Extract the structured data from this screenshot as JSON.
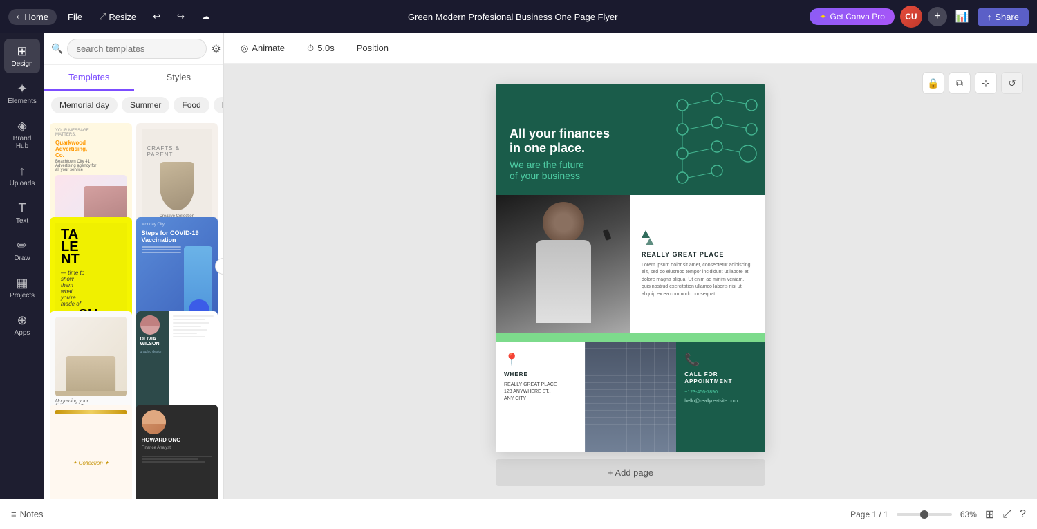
{
  "topbar": {
    "home_label": "Home",
    "file_label": "File",
    "resize_label": "Resize",
    "title": "Green Modern Profesional Business One Page Flyer",
    "canva_pro_label": "Get Canva Pro",
    "share_label": "Share",
    "user_initials": "CU"
  },
  "sidebar": {
    "items": [
      {
        "id": "design",
        "label": "Design",
        "icon": "⊞",
        "active": true
      },
      {
        "id": "elements",
        "label": "Elements",
        "icon": "✦"
      },
      {
        "id": "brand-hub",
        "label": "Brand Hub",
        "icon": "◈"
      },
      {
        "id": "uploads",
        "label": "Uploads",
        "icon": "↑"
      },
      {
        "id": "text",
        "label": "Text",
        "icon": "T"
      },
      {
        "id": "draw",
        "label": "Draw",
        "icon": "✏"
      },
      {
        "id": "projects",
        "label": "Projects",
        "icon": "▦"
      },
      {
        "id": "apps",
        "label": "Apps",
        "icon": "⊕"
      }
    ]
  },
  "templates_panel": {
    "search_placeholder": "search templates",
    "tab_templates": "Templates",
    "tab_styles": "Styles",
    "categories": [
      "Memorial day",
      "Summer",
      "Food",
      "Blue"
    ],
    "more_icon": "›"
  },
  "toolbar": {
    "animate_label": "Animate",
    "duration_label": "5.0s",
    "position_label": "Position"
  },
  "canvas": {
    "document_title": "All your finances\nin one place.",
    "document_subtitle": "We are the future\nof your business",
    "company_name": "REALLY GREAT PLACE",
    "body_text": "Lorem ipsum dolor sit amet, consectetur adipiscing elit, sed do eiusmod tempor incididunt ut labore et dolore magna aliqua. Ut enim ad minim veniam, quis nostrud exercitation ullamco laboris nisi ut aliquip ex ea commodo consequat.",
    "where_title": "WHERE",
    "where_address": "REALLY GREAT PLACE\n123 ANYWHERE ST.,\nANY CITY",
    "call_title": "CALL FOR\nAPPOINTMENT",
    "call_number": "+123-456-7890",
    "call_email": "hello@reallyreatsite.com",
    "add_page_label": "+ Add page"
  },
  "bottom": {
    "notes_label": "Notes",
    "page_indicator": "Page 1 / 1",
    "zoom_level": "63%"
  },
  "template_cards": [
    {
      "id": 1,
      "type": "advertising",
      "has_video": false
    },
    {
      "id": 2,
      "type": "product",
      "has_video": true
    },
    {
      "id": 3,
      "type": "talent",
      "has_video": false
    },
    {
      "id": 4,
      "type": "vaccination",
      "has_video": false
    },
    {
      "id": 5,
      "type": "interior",
      "has_video": false
    },
    {
      "id": 6,
      "type": "resume",
      "has_video": false
    },
    {
      "id": 7,
      "type": "gold-frame",
      "has_video": false
    },
    {
      "id": 8,
      "type": "profile",
      "has_video": false
    }
  ]
}
